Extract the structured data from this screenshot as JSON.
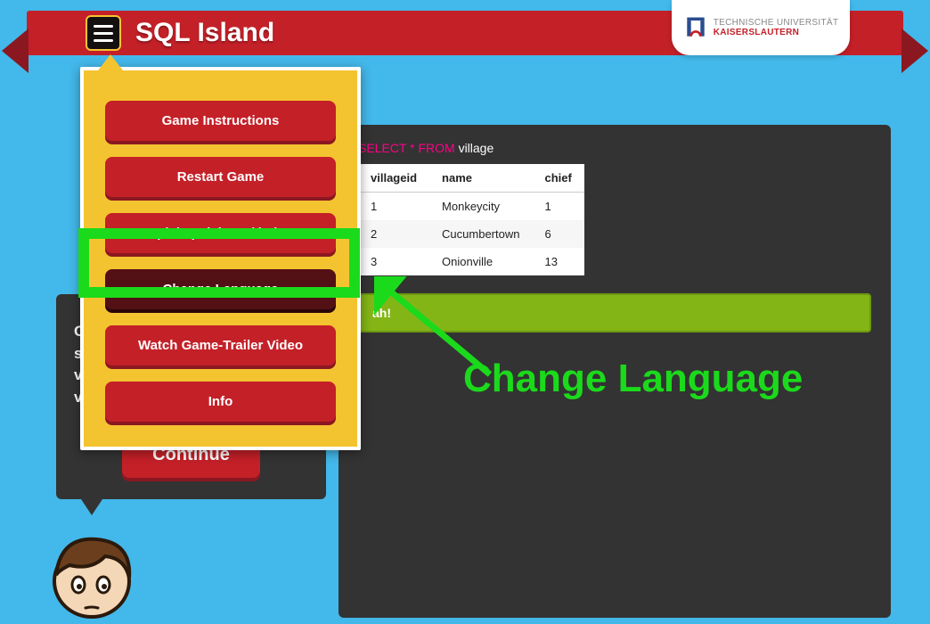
{
  "header": {
    "title": "SQL Island",
    "university_line1": "TECHNISCHE UNIVERSITÄT",
    "university_line2": "KAISERSLAUTERN"
  },
  "menu": {
    "items": [
      {
        "label": "Game Instructions",
        "style": "normal"
      },
      {
        "label": "Restart Game",
        "style": "normal"
      },
      {
        "label": "Spiel speichern / laden",
        "style": "normal"
      },
      {
        "label": "Change Language",
        "style": "dark"
      },
      {
        "label": "Watch Game-Trailer Video",
        "style": "normal"
      },
      {
        "label": "Info",
        "style": "normal"
      }
    ]
  },
  "left": {
    "text_line1": "C",
    "text_line2": "s",
    "text_line3": "v",
    "text_line4": "v",
    "continue_label": "Continue"
  },
  "sql": {
    "select": "SELECT",
    "star": "*",
    "from": "FROM",
    "table": "village"
  },
  "table": {
    "headers": [
      "villageid",
      "name",
      "chief"
    ],
    "rows": [
      [
        "1",
        "Monkeycity",
        "1"
      ],
      [
        "2",
        "Cucumbertown",
        "6"
      ],
      [
        "3",
        "Onionville",
        "13"
      ]
    ]
  },
  "success": "ah!",
  "annotation": "Change Language"
}
